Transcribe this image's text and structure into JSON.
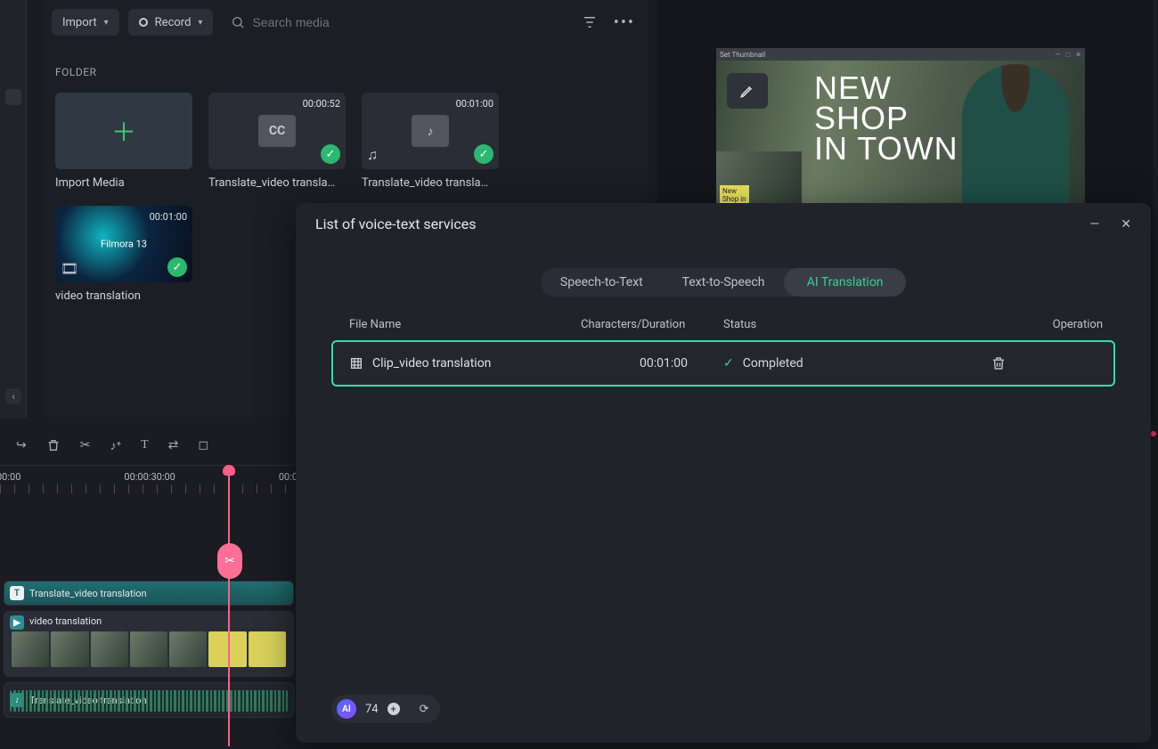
{
  "topbar": {
    "import_label": "Import",
    "record_label": "Record",
    "search_placeholder": "Search media"
  },
  "folder_label": "FOLDER",
  "media_items": [
    {
      "name": "Import Media",
      "kind": "import"
    },
    {
      "name": "Translate_video transla…",
      "duration": "00:00:52",
      "kind": "cc"
    },
    {
      "name": "Translate_video transla…",
      "duration": "00:01:00",
      "kind": "audio"
    },
    {
      "name": "video translation",
      "duration": "00:01:00",
      "kind": "video"
    }
  ],
  "preview": {
    "titlebar": "Set Thumbnail",
    "headline_l1": "NEW",
    "headline_l2": "SHOP",
    "headline_l3": "IN TOWN",
    "pip_tag_l1": "New",
    "pip_tag_l2": "Shop in"
  },
  "timeline": {
    "ruler": [
      "00:00",
      "00:00:30:00",
      "00:0"
    ],
    "tracks": {
      "subtitle": "Translate_video translation",
      "video": "video translation",
      "audio": "Translate_video translation"
    }
  },
  "modal": {
    "title": "List of voice-text services",
    "tabs": [
      "Speech-to-Text",
      "Text-to-Speech",
      "AI Translation"
    ],
    "active_tab": 2,
    "columns": {
      "file": "File Name",
      "dur": "Characters/Duration",
      "status": "Status",
      "op": "Operation"
    },
    "rows": [
      {
        "file": "Clip_video translation",
        "dur": "00:01:00",
        "status": "Completed"
      }
    ],
    "credits": "74"
  }
}
